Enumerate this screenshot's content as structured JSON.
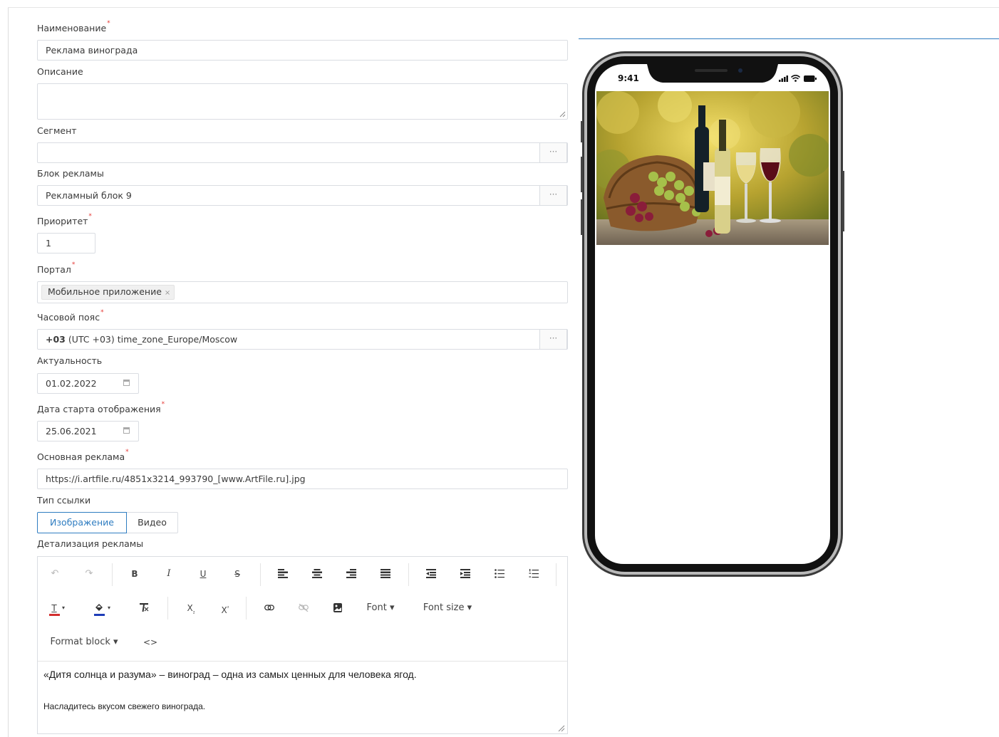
{
  "form": {
    "name": {
      "label": "Наименование",
      "value": "Реклама винограда"
    },
    "description": {
      "label": "Описание",
      "value": ""
    },
    "segment": {
      "label": "Сегмент",
      "value": "",
      "picker": "···"
    },
    "ad_block": {
      "label": "Блок рекламы",
      "value": "Рекламный блок 9",
      "picker": "···"
    },
    "priority": {
      "label": "Приоритет",
      "value": "1"
    },
    "portal": {
      "label": "Портал",
      "tag": "Мобильное приложение",
      "tag_remove": "×"
    },
    "timezone": {
      "label": "Часовой пояс",
      "value_bold": "+03",
      "value_rest": " (UTC +03) time_zone_Europe/Moscow",
      "picker": "···"
    },
    "actuality": {
      "label": "Актуальность",
      "value": "01.02.2022"
    },
    "start_date": {
      "label": "Дата старта отображения",
      "value": "25.06.2021"
    },
    "main_ad": {
      "label": "Основная реклама",
      "value": "https://i.artfile.ru/4851x3214_993790_[www.ArtFile.ru].jpg"
    },
    "link_type": {
      "label": "Тип ссылки",
      "options": [
        "Изображение",
        "Видео"
      ],
      "selected": "Изображение"
    },
    "details": {
      "label": "Детализация рекламы"
    },
    "required_mark": "*"
  },
  "editor": {
    "toolbar": {
      "undo": "↶",
      "redo": "↷",
      "bold": "B",
      "italic": "I",
      "underline": "U",
      "strike": "S",
      "sub": "X",
      "sup": "X",
      "sub_mark": "₂",
      "sup_mark": "²",
      "font": "Font ▾",
      "font_size": "Font size ▾",
      "format_block": "Format block ▾",
      "code": "<>"
    },
    "colors": {
      "text": "#d32f2f",
      "background": "#1e3db8"
    },
    "content": {
      "line1": "«Дитя солнца и разума» – виноград – одна из самых ценных для человека ягод.",
      "line2": "Насладитесь вкусом свежего винограда."
    }
  },
  "preview": {
    "time": "9:41"
  },
  "colors": {
    "accent": "#2f7dc1",
    "required": "#e53935",
    "border": "#dadde2"
  }
}
